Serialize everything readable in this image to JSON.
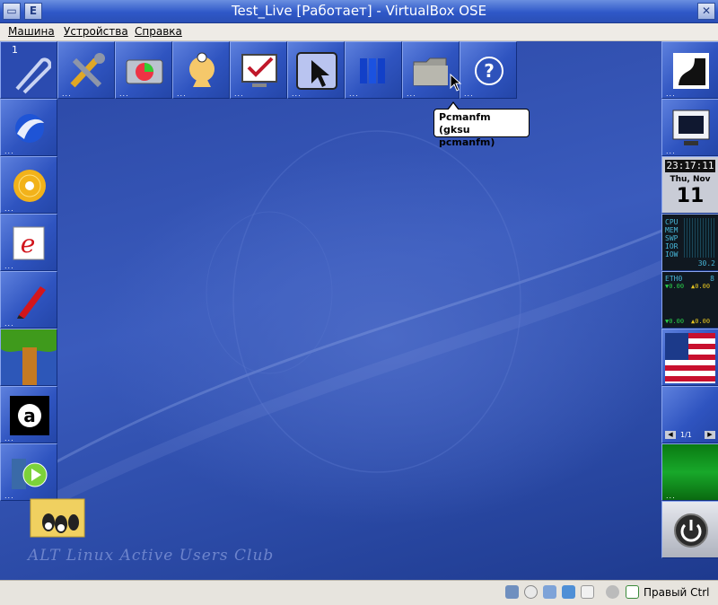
{
  "window": {
    "title": "Test_Live [Работает] - VirtualBox OSE",
    "sys_icon": "window-menu-icon",
    "e_label": "E",
    "close_icon": "close-icon"
  },
  "menu": {
    "items": [
      "Машина",
      "Устройства",
      "Справка"
    ]
  },
  "dock_top": [
    {
      "name": "1-workspace-pager",
      "label": "1",
      "icon": "paperclip-icon"
    },
    {
      "name": "settings",
      "icon": "tools-icon"
    },
    {
      "name": "disk-utility",
      "icon": "harddisk-icon"
    },
    {
      "name": "doctor",
      "icon": "doctor-icon"
    },
    {
      "name": "checklist",
      "icon": "monitor-check-icon"
    },
    {
      "name": "pointer-tool",
      "icon": "cursor-icon"
    },
    {
      "name": "library",
      "icon": "books-icon"
    },
    {
      "name": "pcmanfm",
      "icon": "folder-icon"
    },
    {
      "name": "help",
      "icon": "help-icon"
    }
  ],
  "dock_left": [
    {
      "name": "browser",
      "icon": "seamonkey-icon"
    },
    {
      "name": "cd-player",
      "icon": "cd-icon"
    },
    {
      "name": "mail",
      "icon": "e-mail-icon"
    },
    {
      "name": "editor",
      "icon": "pen-icon"
    },
    {
      "name": "tree",
      "icon": "tree-icon"
    },
    {
      "name": "a-app",
      "icon": "a-letter-icon"
    },
    {
      "name": "video-player",
      "icon": "film-play-icon"
    }
  ],
  "dock_right": {
    "top_app": "terminal-icon",
    "monitor": "monitor-icon",
    "clock": {
      "time": "23:17:11",
      "day": "Thu, Nov",
      "date": "11"
    },
    "cpu_labels": [
      "CPU",
      "MEM",
      "SWP",
      "IOR",
      "IOW"
    ],
    "cpu_value": "30.2",
    "net": {
      "iface": "ETH0",
      "count": "8",
      "up": "▼0.00",
      "down": "▲0.00",
      "up2": "▼0.00",
      "down2": "▲0.00"
    },
    "flag": "us-flag-icon",
    "pager": "1/1",
    "power": "power-icon"
  },
  "tooltip": {
    "line1": "Pcmanfm",
    "line2": "(gksu pcmanfm)"
  },
  "desktop": {
    "watermark": "ALT Linux Active Users Club",
    "logo": "alt-linux-penguins-logo"
  },
  "statusbar": {
    "host_key": "Правый Ctrl",
    "icons": [
      "harddisk-status-icon",
      "cd-status-icon",
      "network-status-icon",
      "shared-folder-status-icon",
      "usb-status-icon",
      "mouse-integration-icon",
      "hostkey-arrow-icon"
    ]
  },
  "colors": {
    "desktop_blue": "#2c4aa0",
    "titlebar_blue": "#2f58c8",
    "tile_blue": "#3b61cc"
  }
}
